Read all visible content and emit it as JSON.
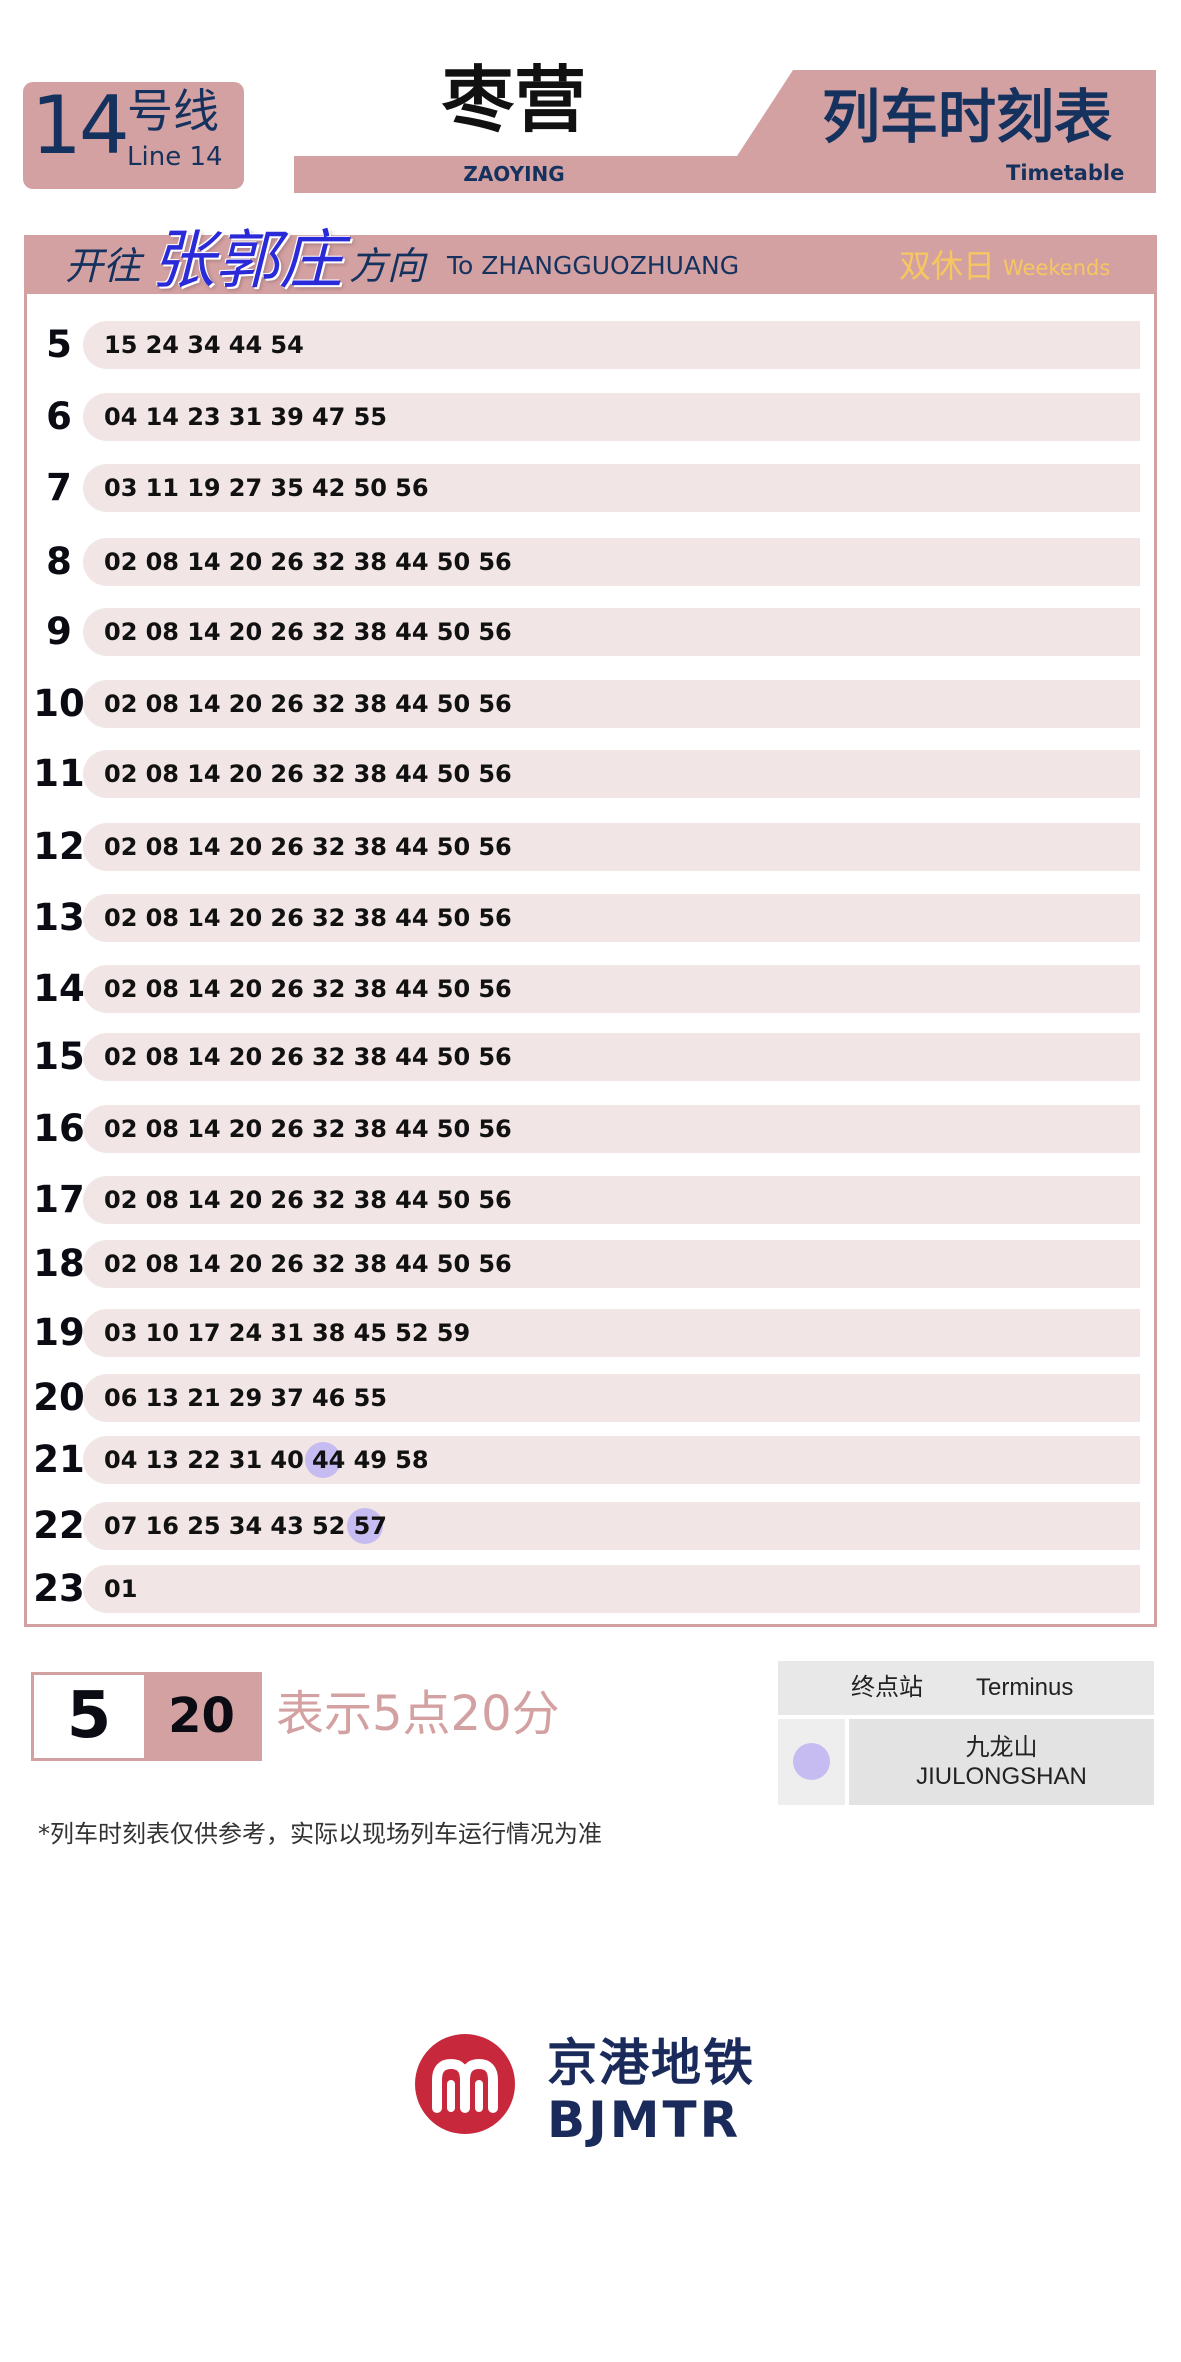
{
  "line": {
    "number": "14",
    "label_zh": "号线",
    "label_en": "Line 14"
  },
  "station": {
    "name_zh": "枣营",
    "name_en": "ZAOYING"
  },
  "title": {
    "zh": "列车时刻表",
    "en": "Timetable"
  },
  "direction": {
    "prefix_zh": "开往",
    "name_zh": "张郭庄",
    "suffix_zh": "方向",
    "en": "To ZHANGGUOZHUANG"
  },
  "day_type": {
    "zh": "双休日",
    "en": "Weekends"
  },
  "colors": {
    "brand_pink": "#d4a1a2",
    "row_tint": "#f1e5e5",
    "navy": "#15325e",
    "terminus_marker": "#c7bcf2",
    "weekend_text": "#f6c760"
  },
  "timetable": [
    {
      "hour": "5",
      "minutes": [
        "15",
        "24",
        "34",
        "44",
        "54"
      ]
    },
    {
      "hour": "6",
      "minutes": [
        "04",
        "14",
        "23",
        "31",
        "39",
        "47",
        "55"
      ]
    },
    {
      "hour": "7",
      "minutes": [
        "03",
        "11",
        "19",
        "27",
        "35",
        "42",
        "50",
        "56"
      ]
    },
    {
      "hour": "8",
      "minutes": [
        "02",
        "08",
        "14",
        "20",
        "26",
        "32",
        "38",
        "44",
        "50",
        "56"
      ]
    },
    {
      "hour": "9",
      "minutes": [
        "02",
        "08",
        "14",
        "20",
        "26",
        "32",
        "38",
        "44",
        "50",
        "56"
      ]
    },
    {
      "hour": "10",
      "minutes": [
        "02",
        "08",
        "14",
        "20",
        "26",
        "32",
        "38",
        "44",
        "50",
        "56"
      ]
    },
    {
      "hour": "11",
      "minutes": [
        "02",
        "08",
        "14",
        "20",
        "26",
        "32",
        "38",
        "44",
        "50",
        "56"
      ]
    },
    {
      "hour": "12",
      "minutes": [
        "02",
        "08",
        "14",
        "20",
        "26",
        "32",
        "38",
        "44",
        "50",
        "56"
      ]
    },
    {
      "hour": "13",
      "minutes": [
        "02",
        "08",
        "14",
        "20",
        "26",
        "32",
        "38",
        "44",
        "50",
        "56"
      ]
    },
    {
      "hour": "14",
      "minutes": [
        "02",
        "08",
        "14",
        "20",
        "26",
        "32",
        "38",
        "44",
        "50",
        "56"
      ]
    },
    {
      "hour": "15",
      "minutes": [
        "02",
        "08",
        "14",
        "20",
        "26",
        "32",
        "38",
        "44",
        "50",
        "56"
      ]
    },
    {
      "hour": "16",
      "minutes": [
        "02",
        "08",
        "14",
        "20",
        "26",
        "32",
        "38",
        "44",
        "50",
        "56"
      ]
    },
    {
      "hour": "17",
      "minutes": [
        "02",
        "08",
        "14",
        "20",
        "26",
        "32",
        "38",
        "44",
        "50",
        "56"
      ]
    },
    {
      "hour": "18",
      "minutes": [
        "02",
        "08",
        "14",
        "20",
        "26",
        "32",
        "38",
        "44",
        "50",
        "56"
      ]
    },
    {
      "hour": "19",
      "minutes": [
        "03",
        "10",
        "17",
        "24",
        "31",
        "38",
        "45",
        "52",
        "59"
      ]
    },
    {
      "hour": "20",
      "minutes": [
        "06",
        "13",
        "21",
        "29",
        "37",
        "46",
        "55"
      ]
    },
    {
      "hour": "21",
      "minutes": [
        "04",
        "13",
        "22",
        "31",
        "40",
        "44",
        "49",
        "58"
      ],
      "terminus_marked": [
        "44"
      ]
    },
    {
      "hour": "22",
      "minutes": [
        "07",
        "16",
        "25",
        "34",
        "43",
        "52",
        "57"
      ],
      "terminus_marked": [
        "57"
      ]
    },
    {
      "hour": "23",
      "minutes": [
        "01"
      ]
    }
  ],
  "legend": {
    "hour": "5",
    "minute": "20",
    "text": "表示5点20分"
  },
  "terminus": {
    "header_zh": "终点站",
    "header_en": "Terminus",
    "name_zh": "九龙山",
    "name_en": "JIULONGSHAN"
  },
  "note": "*列车时刻表仅供参考，实际以现场列车运行情况为准",
  "logo": {
    "zh": "京港地铁",
    "en": "BJMTR"
  }
}
